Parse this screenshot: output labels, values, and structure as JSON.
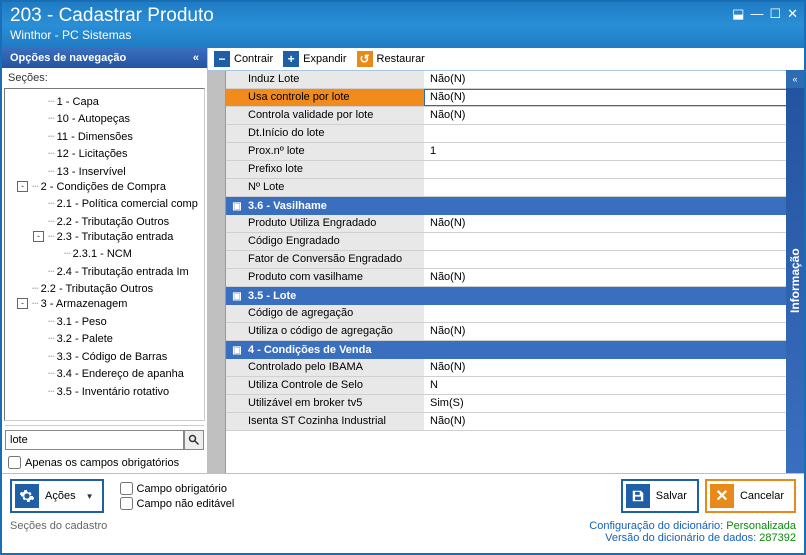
{
  "window": {
    "title": "203 - Cadastrar  Produto",
    "subtitle": "Winthor - PC Sistemas"
  },
  "sidebar": {
    "header": "Opções de navegação",
    "secoes": "Seções:",
    "tree": [
      {
        "level": 1,
        "exp": null,
        "label": "1 - Capa"
      },
      {
        "level": 1,
        "exp": null,
        "label": "10 - Autopeças"
      },
      {
        "level": 1,
        "exp": null,
        "label": "11 - Dimensões"
      },
      {
        "level": 1,
        "exp": null,
        "label": "12 - Licitações"
      },
      {
        "level": 1,
        "exp": null,
        "label": "13 - Inservível"
      },
      {
        "level": 0,
        "exp": "-",
        "label": "2 - Condições de Compra"
      },
      {
        "level": 1,
        "exp": null,
        "label": "2.1 - Política comercial comp"
      },
      {
        "level": 1,
        "exp": null,
        "label": "2.2 - Tributação Outros"
      },
      {
        "level": 1,
        "exp": "-",
        "label": "2.3 - Tributação entrada"
      },
      {
        "level": 2,
        "exp": null,
        "label": "2.3.1 - NCM"
      },
      {
        "level": 1,
        "exp": null,
        "label": "2.4 - Tributação entrada Im"
      },
      {
        "level": 0,
        "exp": null,
        "label": "2.2 - Tributação Outros"
      },
      {
        "level": 0,
        "exp": "-",
        "label": "3 - Armazenagem"
      },
      {
        "level": 1,
        "exp": null,
        "label": "3.1 - Peso"
      },
      {
        "level": 1,
        "exp": null,
        "label": "3.2 - Palete"
      },
      {
        "level": 1,
        "exp": null,
        "label": "3.3 - Código de Barras"
      },
      {
        "level": 1,
        "exp": null,
        "label": "3.4 - Endereço de apanha"
      },
      {
        "level": 1,
        "exp": null,
        "label": "3.5 - Inventário rotativo"
      }
    ],
    "search_value": "lote",
    "chk_label": "Apenas os campos obrigatórios"
  },
  "toolbar": {
    "contrair": "Contrair",
    "expandir": "Expandir",
    "restaurar": "Restaurar"
  },
  "rows": [
    {
      "type": "row",
      "label": "Induz Lote",
      "value": "Não(N)",
      "dd": true
    },
    {
      "type": "row",
      "label": "Usa controle por lote",
      "value": "Não(N)",
      "dd": true,
      "selected": true
    },
    {
      "type": "row",
      "label": "Controla validade por lote",
      "value": "Não(N)",
      "dd": true
    },
    {
      "type": "row",
      "label": "Dt.Início do lote",
      "value": "",
      "dd": true
    },
    {
      "type": "row",
      "label": "Prox.nº lote",
      "value": "1",
      "dd": false
    },
    {
      "type": "row",
      "label": "Prefixo lote",
      "value": "",
      "dd": false
    },
    {
      "type": "row",
      "label": "Nº Lote",
      "value": "",
      "dd": false
    },
    {
      "type": "section",
      "label": "3.6 - Vasilhame"
    },
    {
      "type": "row",
      "label": "Produto Utiliza Engradado",
      "value": "Não(N)",
      "dd": true
    },
    {
      "type": "row",
      "label": "Código Engradado",
      "value": "",
      "dd": false
    },
    {
      "type": "row",
      "label": "Fator de Conversão Engradado",
      "value": "",
      "dd": false
    },
    {
      "type": "row",
      "label": "Produto com vasilhame",
      "value": "Não(N)",
      "dd": true
    },
    {
      "type": "section",
      "label": "3.5 - Lote"
    },
    {
      "type": "row",
      "label": "Código de agregação",
      "value": "",
      "dd": false
    },
    {
      "type": "row",
      "label": "Utiliza o código de agregação",
      "value": "Não(N)",
      "dd": true
    },
    {
      "type": "section",
      "label": "4 - Condições de Venda"
    },
    {
      "type": "row",
      "label": "Controlado pelo IBAMA",
      "value": "Não(N)",
      "dd": true
    },
    {
      "type": "row",
      "label": "Utiliza Controle de Selo",
      "value": "N",
      "dd": false
    },
    {
      "type": "row",
      "label": "Utilizável em broker tv5",
      "value": "Sim(S)",
      "dd": true
    },
    {
      "type": "row",
      "label": "Isenta ST Cozinha Industrial",
      "value": "Não(N)",
      "dd": true
    }
  ],
  "info_tab": "Informação",
  "footer": {
    "acoes": "Ações",
    "legend_obrig": "Campo obrigatório",
    "legend_naoed": "Campo não editável",
    "salvar": "Salvar",
    "cancelar": "Cancelar",
    "secoes_cadastro": "Seções do cadastro",
    "config_label": "Configuração do dicionário:",
    "config_val": "Personalizada",
    "versao_label": "Versão do dicionário de dados:",
    "versao_val": "287392"
  }
}
